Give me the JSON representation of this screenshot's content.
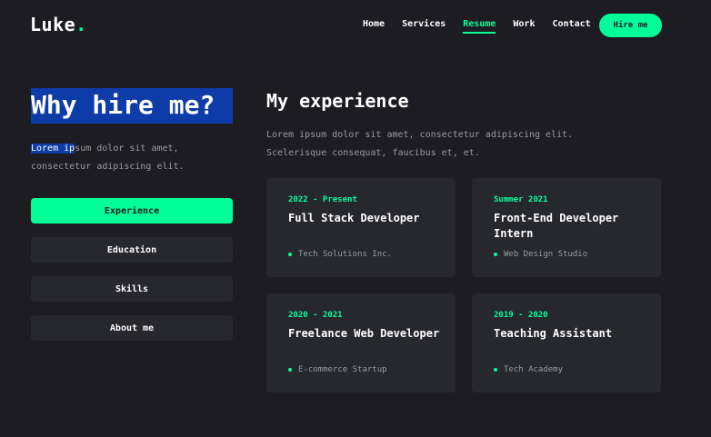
{
  "brand": {
    "name": "Luke",
    "dot": "."
  },
  "nav": {
    "items": [
      {
        "label": "Home",
        "active": false
      },
      {
        "label": "Services",
        "active": false
      },
      {
        "label": "Resume",
        "active": true
      },
      {
        "label": "Work",
        "active": false
      },
      {
        "label": "Contact",
        "active": false
      }
    ],
    "hire_label": "Hire me"
  },
  "about": {
    "title": "Why hire me?",
    "desc_selected": "Lorem ip",
    "desc_rest": "sum dolor sit amet, consectetur adipiscing elit."
  },
  "tabs": [
    {
      "label": "Experience",
      "active": true
    },
    {
      "label": "Education",
      "active": false
    },
    {
      "label": "Skills",
      "active": false
    },
    {
      "label": "About me",
      "active": false
    }
  ],
  "experience": {
    "title": "My experience",
    "desc": "Lorem ipsum dolor sit amet, consectetur adipiscing elit. Scelerisque consequat, faucibus et, et.",
    "items": [
      {
        "date": "2022 - Present",
        "role": "Full Stack Developer",
        "org": "Tech Solutions Inc."
      },
      {
        "date": "Summer 2021",
        "role": "Front-End Developer Intern",
        "org": "Web Design Studio"
      },
      {
        "date": "2020 - 2021",
        "role": "Freelance Web Developer",
        "org": "E-commerce Startup"
      },
      {
        "date": "2019 - 2020",
        "role": "Teaching Assistant",
        "org": "Tech Academy"
      }
    ]
  },
  "colors": {
    "accent": "#00ff99",
    "background": "#1c1c22",
    "card": "#27272e",
    "selection": "#0d3ba8"
  }
}
